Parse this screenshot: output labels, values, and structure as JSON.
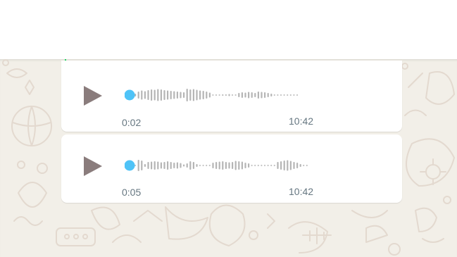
{
  "colors": {
    "app_background": "#f2efe8",
    "bubble": "#ffffff",
    "play_icon": "#8a7c7c",
    "progress_dot": "#4fc3f7",
    "waveform_bar": "#b5b5b5",
    "waveform_dot": "#c4c4c4",
    "meta_text": "#667781",
    "doodle": "#e3d9cf"
  },
  "icons": {
    "play": "play-icon",
    "progress_handle": "progress-dot"
  },
  "messages": [
    {
      "duration": "0:02",
      "time": "10:42",
      "progress": 0
    },
    {
      "duration": "0:05",
      "time": "10:42",
      "progress": 0
    }
  ]
}
